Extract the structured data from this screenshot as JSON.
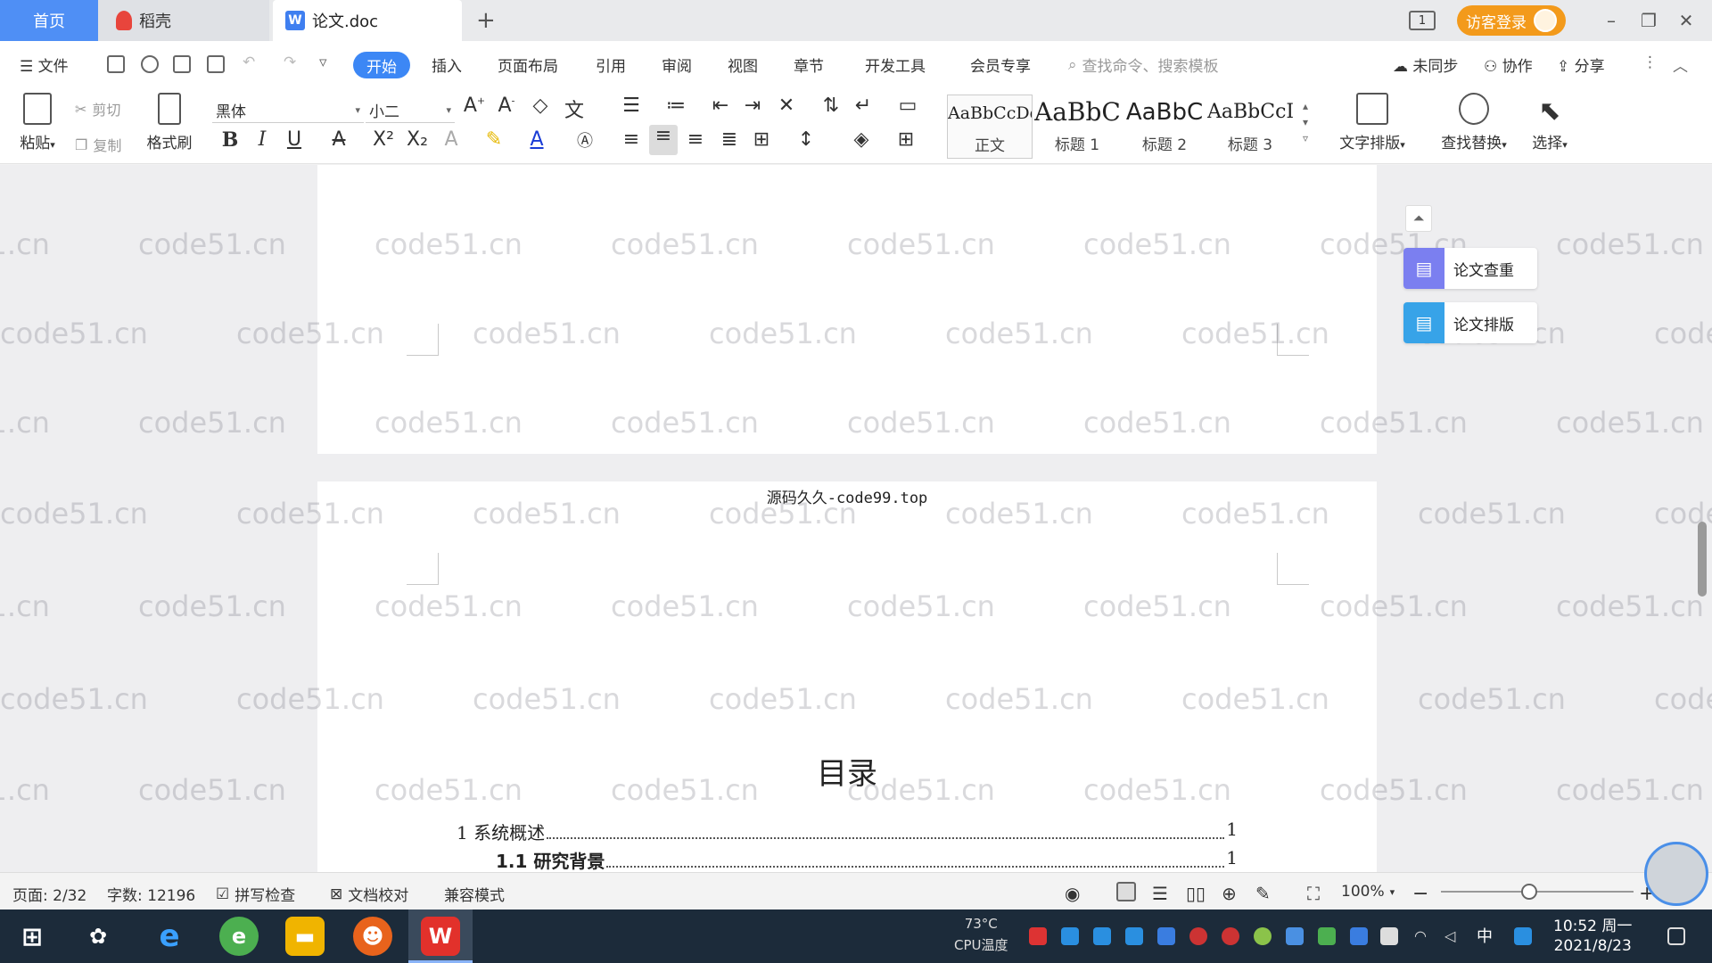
{
  "titlebar": {
    "tabs": [
      {
        "label": "首页"
      },
      {
        "label": "稻壳"
      },
      {
        "label": "论文.doc"
      }
    ],
    "login_label": "访客登录"
  },
  "menu": {
    "file": "文件",
    "items": [
      "开始",
      "插入",
      "页面布局",
      "引用",
      "审阅",
      "视图",
      "章节",
      "开发工具",
      "会员专享"
    ],
    "search_placeholder": "查找命令、搜索模板",
    "sync": "未同步",
    "collab": "协作",
    "share": "分享"
  },
  "ribbon": {
    "paste": "粘贴",
    "cut": "剪切",
    "copy": "复制",
    "format_painter": "格式刷",
    "font_name": "黑体",
    "font_size": "小二",
    "styles": [
      {
        "sample": "AaBbCcDd",
        "label": "正文"
      },
      {
        "sample": "AaBbC",
        "label": "标题 1"
      },
      {
        "sample": "AaBbC",
        "label": "标题 2"
      },
      {
        "sample": "AaBbCcI",
        "label": "标题 3"
      }
    ],
    "text_layout": "文字排版",
    "find_replace": "查找替换",
    "select": "选择"
  },
  "document": {
    "header_text": "源码久久-code99.top",
    "toc_title": "目录",
    "toc": [
      {
        "title": "1 系统概述",
        "page": "1"
      },
      {
        "title": "1.1  研究背景",
        "page": "1"
      }
    ],
    "watermark": "code51.cn"
  },
  "side_panel": {
    "check": "论文查重",
    "layout": "论文排版"
  },
  "status": {
    "page": "页面: 2/32",
    "words": "字数: 12196",
    "spell": "拼写检查",
    "proof": "文档校对",
    "compat": "兼容模式",
    "zoom": "100%"
  },
  "taskbar": {
    "cpu_temp": "73°C",
    "cpu_label": "CPU温度",
    "ime": "中",
    "time": "10:52 周一",
    "date": "2021/8/23"
  }
}
